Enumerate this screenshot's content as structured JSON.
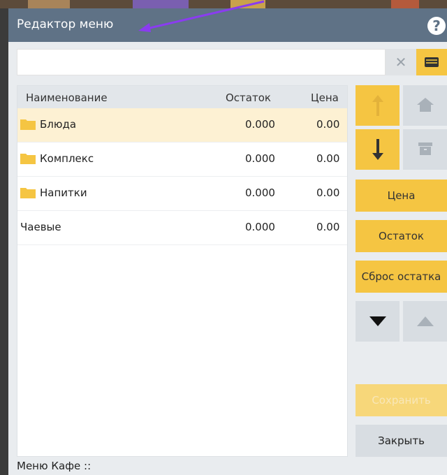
{
  "window": {
    "title": "Редактор меню",
    "help_icon": "question-icon"
  },
  "search": {
    "value": "",
    "placeholder": ""
  },
  "table": {
    "headers": {
      "name": "Наименование",
      "stock": "Остаток",
      "price": "Цена"
    },
    "rows": [
      {
        "name": "Блюда",
        "stock": "0.000",
        "price": "0.00",
        "folder": true,
        "selected": true
      },
      {
        "name": "Комплекс",
        "stock": "0.000",
        "price": "0.00",
        "folder": true,
        "selected": false
      },
      {
        "name": "Напитки",
        "stock": "0.000",
        "price": "0.00",
        "folder": true,
        "selected": false
      },
      {
        "name": "Чаевые",
        "stock": "0.000",
        "price": "0.00",
        "folder": false,
        "selected": false
      }
    ]
  },
  "buttons": {
    "price": "Цена",
    "stock": "Остаток",
    "reset_stock": "Сброс остатка",
    "save": "Сохранить",
    "close": "Закрыть"
  },
  "status": {
    "text": "Меню Кафе ::"
  },
  "colors": {
    "accent": "#f5c542",
    "titlebar": "#5f7286",
    "selected_row": "#fdf1d3",
    "annotation_arrow": "#8a3cf0"
  }
}
